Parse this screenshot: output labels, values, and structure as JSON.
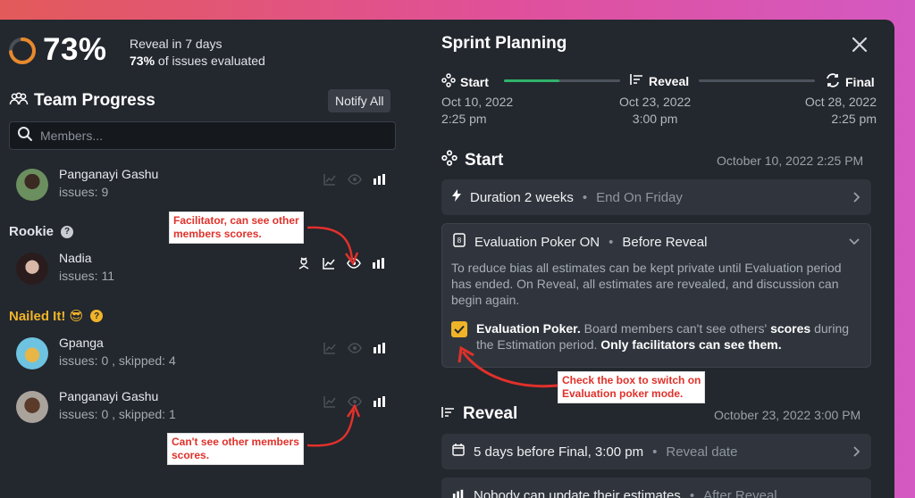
{
  "left": {
    "progress_pct": "73%",
    "progress_fraction": 0.73,
    "reveal_text": "Reveal in 7 days",
    "evaluated_pct": "73%",
    "evaluated_text": "of issues evaluated",
    "team_title": "Team Progress",
    "notify_label": "Notify All",
    "search_placeholder": "Members...",
    "members": [
      {
        "name": "Panganayi Gashu",
        "issues": "issues: 9"
      },
      {
        "name": "Nadia",
        "issues": "issues: 11"
      },
      {
        "name": "Gpanga",
        "issues": "issues: 0 , skipped: 4"
      },
      {
        "name": "Panganayi Gashu",
        "issues": "issues: 0 , skipped: 1"
      }
    ],
    "groups": {
      "rookie": "Rookie",
      "nailed": "Nailed It! 😎"
    },
    "qmark": "?"
  },
  "callouts": {
    "facilitator_1": "Facilitator, can see other",
    "facilitator_2": "members scores.",
    "cant_see_1": "Can't see other members",
    "cant_see_2": "scores.",
    "check_box_1": "Check the box to switch on",
    "check_box_2": "Evaluation poker mode."
  },
  "right": {
    "title": "Sprint Planning",
    "stages": [
      {
        "label": "Start",
        "date": "Oct 10, 2022",
        "time": "2:25 pm"
      },
      {
        "label": "Reveal",
        "date": "Oct 23, 2022",
        "time": "3:00 pm"
      },
      {
        "label": "Final",
        "date": "Oct 28, 2022",
        "time": "2:25 pm"
      }
    ],
    "start_section": {
      "title": "Start",
      "date": "October 10, 2022 2:25 PM",
      "duration": "Duration 2 weeks",
      "end_on": "End On Friday",
      "poker_title": "Evaluation Poker ON",
      "poker_sub": "Before Reveal",
      "poker_desc": "To reduce bias all estimates can be kept private until Evaluation period has ended. On Reveal, all estimates are revealed, and discussion can begin again.",
      "check_bold": "Evaluation Poker.",
      "check_text_a": "Board members can't see others'",
      "check_scores": "scores",
      "check_text_b": "during the Estimation period.",
      "check_bold2": "Only facilitators can see them."
    },
    "reveal_section": {
      "title": "Reveal",
      "date": "October 23, 2022 3:00 PM",
      "row1": "5 days before Final, 3:00 pm",
      "row1_muted": "Reveal date",
      "row2": "Nobody can update their estimates",
      "row2_muted": "After Reveal"
    },
    "dot": "•"
  },
  "colors": {
    "accent_green": "#2fb36b",
    "progress_orange": "#e8892b",
    "checkbox_yellow": "#f0b429",
    "callout_red": "#e0312a"
  }
}
